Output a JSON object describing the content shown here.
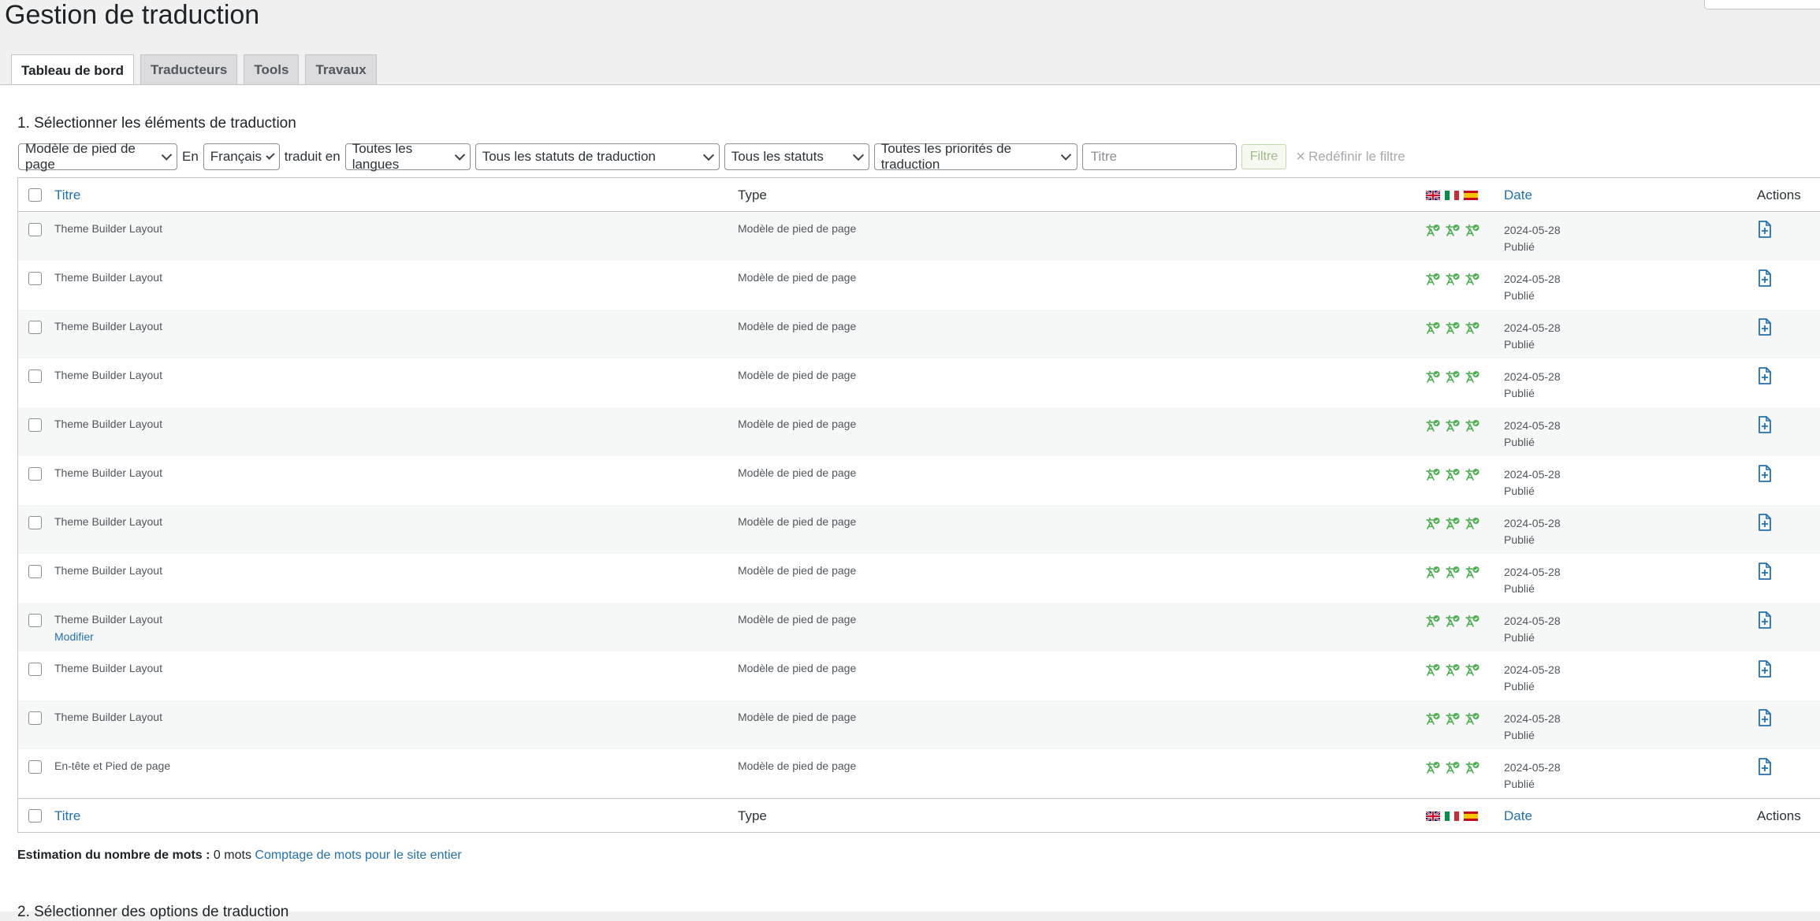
{
  "page": {
    "title": "Gestion de traduction"
  },
  "tabs": [
    {
      "label": "Tableau de bord",
      "active": true
    },
    {
      "label": "Traducteurs",
      "active": false
    },
    {
      "label": "Tools",
      "active": false
    },
    {
      "label": "Travaux",
      "active": false
    }
  ],
  "section1": {
    "title": "1. Sélectionner les éléments de traduction"
  },
  "filters": {
    "type": "Modèle de pied de page",
    "in_label": "En",
    "language": "Français",
    "translated_label": "traduit en",
    "target": "Toutes les langues",
    "translation_status": "Tous les statuts de traduction",
    "status": "Tous les statuts",
    "priority": "Toutes les priorités de traduction",
    "title_placeholder": "Titre",
    "filter_button": "Filtre",
    "reset": "Redéfinir le filtre"
  },
  "columns": {
    "title": "Titre",
    "type": "Type",
    "date": "Date",
    "actions": "Actions"
  },
  "flags": [
    "flag-uk-icon",
    "flag-italy-icon",
    "flag-spain-icon"
  ],
  "rows": [
    {
      "title": "Theme Builder Layout",
      "type": "Modèle de pied de page",
      "date": "2024-05-28",
      "status": "Publié"
    },
    {
      "title": "Theme Builder Layout",
      "type": "Modèle de pied de page",
      "date": "2024-05-28",
      "status": "Publié"
    },
    {
      "title": "Theme Builder Layout",
      "type": "Modèle de pied de page",
      "date": "2024-05-28",
      "status": "Publié"
    },
    {
      "title": "Theme Builder Layout",
      "type": "Modèle de pied de page",
      "date": "2024-05-28",
      "status": "Publié"
    },
    {
      "title": "Theme Builder Layout",
      "type": "Modèle de pied de page",
      "date": "2024-05-28",
      "status": "Publié"
    },
    {
      "title": "Theme Builder Layout",
      "type": "Modèle de pied de page",
      "date": "2024-05-28",
      "status": "Publié"
    },
    {
      "title": "Theme Builder Layout",
      "type": "Modèle de pied de page",
      "date": "2024-05-28",
      "status": "Publié"
    },
    {
      "title": "Theme Builder Layout",
      "type": "Modèle de pied de page",
      "date": "2024-05-28",
      "status": "Publié"
    },
    {
      "title": "Theme Builder Layout",
      "type": "Modèle de pied de page",
      "date": "2024-05-28",
      "status": "Publié",
      "edit": "Modifier"
    },
    {
      "title": "Theme Builder Layout",
      "type": "Modèle de pied de page",
      "date": "2024-05-28",
      "status": "Publié"
    },
    {
      "title": "Theme Builder Layout",
      "type": "Modèle de pied de page",
      "date": "2024-05-28",
      "status": "Publié"
    },
    {
      "title": "En-tête et Pied de page",
      "type": "Modèle de pied de page",
      "date": "2024-05-28",
      "status": "Publié"
    }
  ],
  "wordcount": {
    "label": "Estimation du nombre de mots :",
    "value": "0 mots",
    "link": "Comptage de mots pour le site entier"
  },
  "section2": {
    "title": "2. Sélectionner des options de traduction"
  },
  "colors": {
    "accent": "#2271b1",
    "complete": "#4caf50"
  }
}
